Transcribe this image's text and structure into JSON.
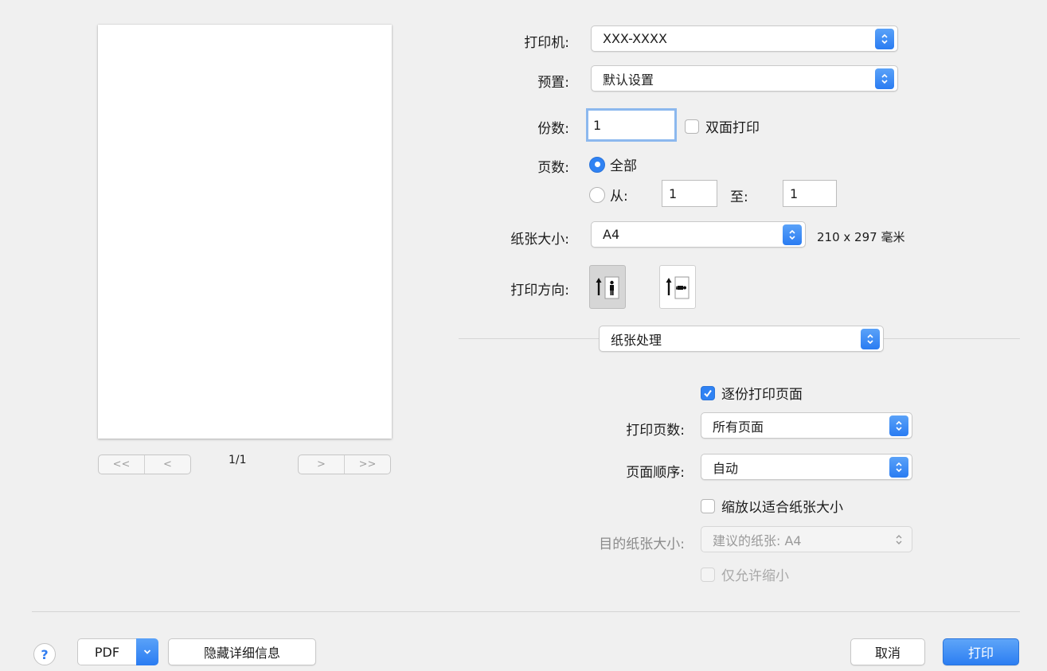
{
  "preview": {
    "page_counter": "1/1",
    "nav": {
      "first": "<<",
      "prev": "<",
      "next": ">",
      "last": ">>"
    }
  },
  "printer": {
    "label": "打印机:",
    "value": "XXX-XXXX"
  },
  "presets": {
    "label": "预置:",
    "value": "默认设置"
  },
  "copies": {
    "label": "份数:",
    "value": "1",
    "duplex_label": "双面打印",
    "duplex_checked": false
  },
  "pages": {
    "label": "页数:",
    "all_label": "全部",
    "from_label": "从:",
    "from_value": "1",
    "to_label": "至:",
    "to_value": "1",
    "selected": "all"
  },
  "paper_size": {
    "label": "纸张大小:",
    "value": "A4",
    "dimensions": "210 x 297 毫米"
  },
  "orientation": {
    "label": "打印方向:",
    "selected": "portrait",
    "options": [
      "portrait-icon",
      "landscape-icon"
    ]
  },
  "section_select": {
    "value": "纸张处理"
  },
  "paper_handling": {
    "collate_label": "逐份打印页面",
    "collate_checked": true,
    "pages_to_print_label": "打印页数:",
    "pages_to_print_value": "所有页面",
    "page_order_label": "页面顺序:",
    "page_order_value": "自动",
    "scale_to_fit_label": "缩放以适合纸张大小",
    "scale_to_fit_checked": false,
    "destination_label": "目的纸张大小:",
    "destination_value": "建议的纸张: A4",
    "scale_down_only_label": "仅允许缩小",
    "scale_down_only_checked": false
  },
  "footer": {
    "help": "?",
    "pdf": "PDF",
    "hide_details": "隐藏详细信息",
    "cancel": "取消",
    "print": "打印"
  },
  "colors": {
    "accent": "#2f82f3",
    "background": "#f0f0f0"
  }
}
